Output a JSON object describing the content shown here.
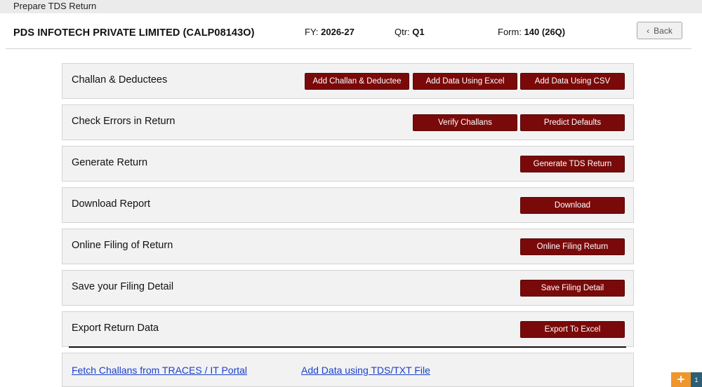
{
  "window": {
    "title": "Prepare TDS Return"
  },
  "header": {
    "company": "PDS INFOTECH PRIVATE LIMITED (CALP08143O)",
    "fy_label": "FY:",
    "fy_value": "2026-27",
    "qtr_label": "Qtr:",
    "qtr_value": "Q1",
    "form_label": "Form:",
    "form_value": "140 (26Q)",
    "back_label": "Back"
  },
  "sections": [
    {
      "label": "Challan & Deductees",
      "buttons": [
        "Add Challan & Deductee",
        "Add Data Using Excel",
        "Add Data Using CSV"
      ]
    },
    {
      "label": "Check Errors in Return",
      "buttons": [
        "Verify Challans",
        "Predict Defaults"
      ]
    },
    {
      "label": "Generate Return",
      "buttons": [
        "Generate TDS Return"
      ]
    },
    {
      "label": "Download Report",
      "buttons": [
        "Download"
      ]
    },
    {
      "label": "Online Filing of Return",
      "buttons": [
        "Online Filing Return"
      ]
    },
    {
      "label": "Save your Filing Detail",
      "buttons": [
        "Save Filing Detail"
      ]
    },
    {
      "label": "Export Return Data",
      "buttons": [
        "Export To Excel"
      ]
    }
  ],
  "links": {
    "fetch_challans": "Fetch Challans from TRACES / IT Portal",
    "add_tds_txt": "Add Data using TDS/TXT File"
  },
  "floating": {
    "plus": "+",
    "side": "1"
  },
  "colors": {
    "button_bg": "#7a0a0a",
    "panel_bg": "#f2f2f2",
    "link": "#1a3fcc",
    "floating": "#f0962e"
  }
}
